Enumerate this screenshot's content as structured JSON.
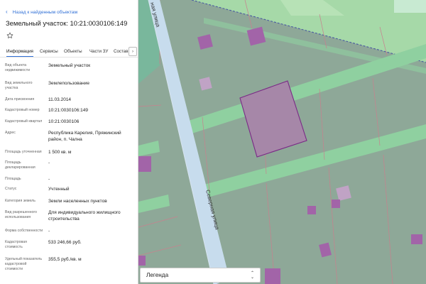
{
  "panel": {
    "back_label": "Назад к найденным объектам",
    "title": "Земельный участок: 10:21:0030106:149",
    "tabs": [
      {
        "label": "Информация"
      },
      {
        "label": "Сервисы"
      },
      {
        "label": "Объекты"
      },
      {
        "label": "Части ЗУ"
      },
      {
        "label": "Состав"
      }
    ],
    "tab_scroll_icon": "chevron-right-icon",
    "rows": [
      {
        "label": "Вид объекта недвижимости",
        "value": "Земельный участок"
      },
      {
        "label": "Вид земельного участка",
        "value": "Землепользование"
      },
      {
        "label": "Дата присвоения",
        "value": "11.03.2014"
      },
      {
        "label": "Кадастровый номер",
        "value": "10:21:0030106:149"
      },
      {
        "label": "Кадастровый квартал",
        "value": "10:21:0030106"
      },
      {
        "label": "Адрес",
        "value": "Республика Карелия, Пряжинский район, п. Чална"
      },
      {
        "label": "Площадь уточненная",
        "value": "1 500 кв. м"
      },
      {
        "label": "Площадь декларированная",
        "value": "-"
      },
      {
        "label": "Площадь",
        "value": "-"
      },
      {
        "label": "Статус",
        "value": "Учтенный"
      },
      {
        "label": "Категория земель",
        "value": "Земли населенных пунктов"
      },
      {
        "label": "Вид разрешенного использования",
        "value": "Для индивидуального жилищного строительства"
      },
      {
        "label": "Форма собственности",
        "value": "-"
      },
      {
        "label": "Кадастровая стоимость",
        "value": "533 246,66 руб."
      },
      {
        "label": "Удельный показатель кадастровой стоимости",
        "value": "355,5 руб./кв. м"
      }
    ]
  },
  "map": {
    "street_label": "Северная улица",
    "legend_label": "Легенда",
    "colors": {
      "parcel_fill": "#8ea898",
      "strip_fill": "#8fd0a0",
      "road_fill": "#c7dced",
      "building_fill": "#a264a8",
      "selected_fill": "#a687a8",
      "forest_fill": "#79b79c",
      "field_fill": "#a6d9a8"
    }
  }
}
